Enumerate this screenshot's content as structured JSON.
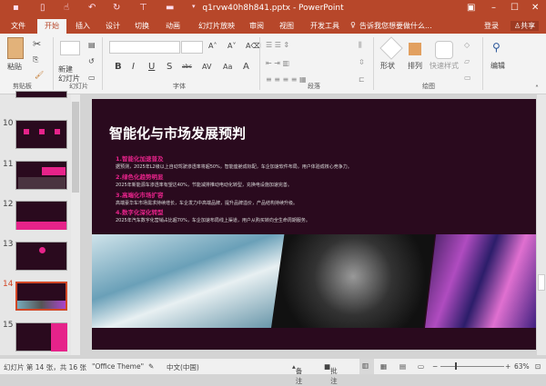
{
  "window": {
    "title": "q1rvw40h8h841.pptx - PowerPoint",
    "qa_icons": [
      "save-icon",
      "new-icon",
      "touch-icon",
      "undo-icon",
      "redo-icon",
      "present-icon",
      "open-icon",
      "customize-icon"
    ]
  },
  "tabs": [
    "文件",
    "开始",
    "插入",
    "设计",
    "切换",
    "动画",
    "幻灯片放映",
    "审阅",
    "视图",
    "开发工具"
  ],
  "tell_me": "告诉我您想要做什么...",
  "login": "登录",
  "share": "共享",
  "ribbon": {
    "paste": "粘贴",
    "new_slide": "新建\n幻灯片",
    "shape": "形状",
    "arrange": "排列",
    "quick_style": "快速样式",
    "edit": "编辑",
    "groups": [
      "剪贴板",
      "幻灯片",
      "字体",
      "段落",
      "绘图"
    ],
    "font_buttons": [
      "B",
      "I",
      "U",
      "S",
      "abc",
      "AV",
      "Aa",
      "A"
    ]
  },
  "thumbnails": [
    {
      "n": "10"
    },
    {
      "n": "11"
    },
    {
      "n": "12"
    },
    {
      "n": "13"
    },
    {
      "n": "14",
      "selected": true
    },
    {
      "n": "15"
    }
  ],
  "slide": {
    "title": "智能化与市场发展预判",
    "points": [
      {
        "heading": "1.智能化加速普及",
        "body": "据预测，2025年L2级以上自动驾驶渗透率将超50%，智能座舱成标配，车企加速软件布局，用户体验成核心竞争力。"
      },
      {
        "heading": "2.绿色化趋势明显",
        "body": "2025年新能源车渗透率有望达40%，节能减排推动电动化转型，充换电设施加速完善。"
      },
      {
        "heading": "3.高端化市场扩容",
        "body": "高端豪华车市场需求持续增长，车企发力中高端品牌，提升品牌溢价，产品结构持续升级。"
      },
      {
        "heading": "4.数字化深化转型",
        "body": "2025年汽车数字化营销占比超70%，车企加速布局线上渠道，用户从购买转向全生命周期服务。"
      }
    ]
  },
  "status": {
    "slide_info": "幻灯片 第 14 张，共 16 张",
    "theme": "\"Office Theme\"",
    "lang": "中文(中国)",
    "notes": "备注",
    "comments": "批注",
    "zoom": "63%"
  },
  "colors": {
    "accent": "#b7472a",
    "slide_bg": "#2a0a1e",
    "pink": "#e6238a"
  }
}
